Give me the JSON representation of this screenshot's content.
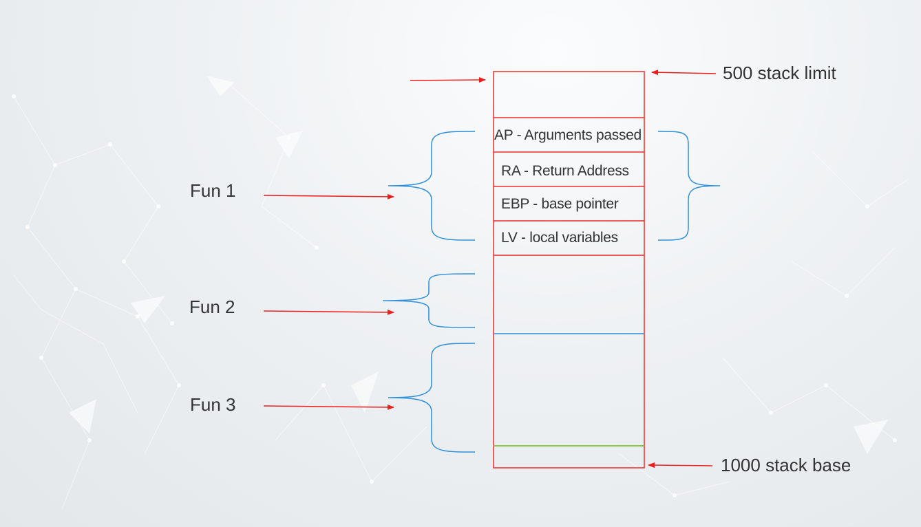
{
  "colors": {
    "stack_outline": "#ee2b2b",
    "arrow": "#ee1c1c",
    "brace": "#2f8fd8",
    "divider_blue": "#2f8fd8",
    "divider_green": "#8cc63f",
    "text": "#333333"
  },
  "top_note": "500 stack limit",
  "bottom_note": "1000 stack base",
  "frame_slots": [
    {
      "label": "AP - Arguments passed"
    },
    {
      "label": "RA - Return Address"
    },
    {
      "label": "EBP -  base pointer"
    },
    {
      "label": "LV - local variables"
    }
  ],
  "functions": [
    {
      "label": "Fun 1"
    },
    {
      "label": "Fun 2"
    },
    {
      "label": "Fun 3"
    }
  ]
}
